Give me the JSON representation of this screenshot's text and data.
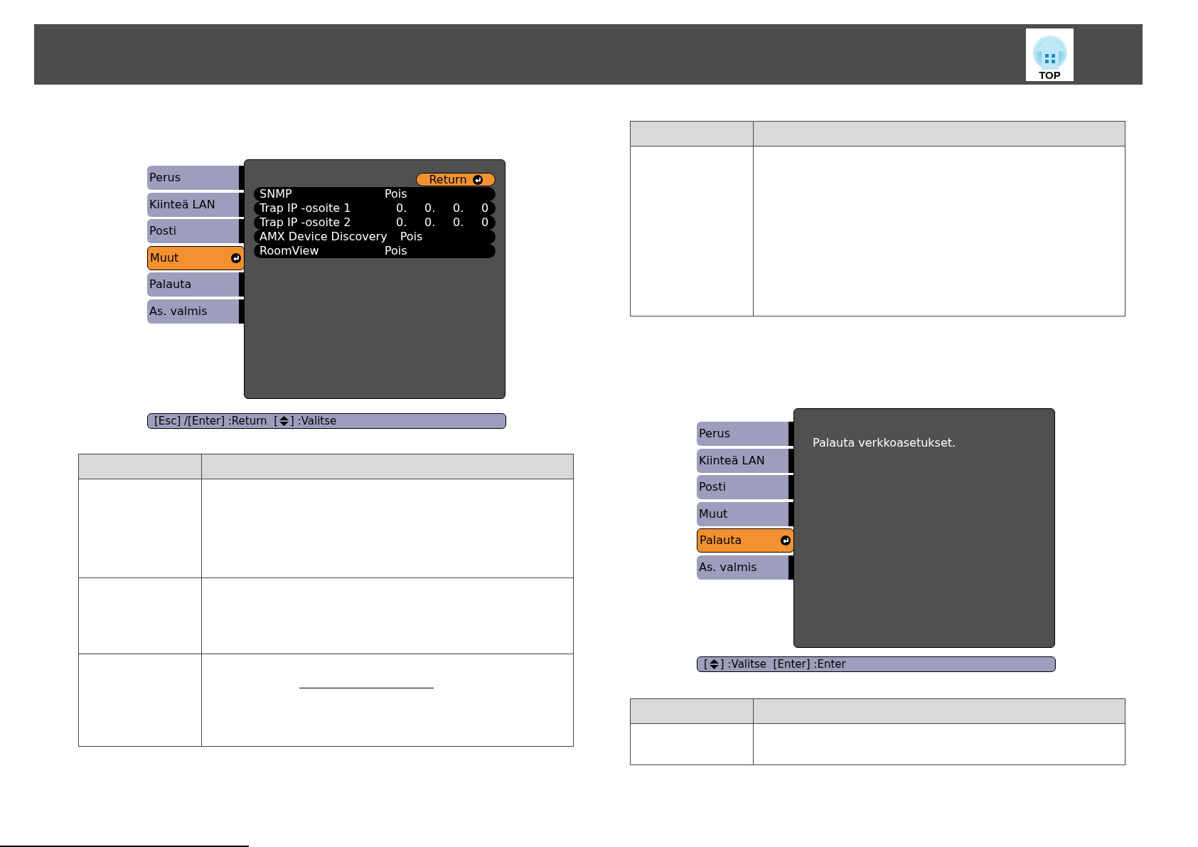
{
  "header": {
    "top_link": {
      "label": "TOP"
    }
  },
  "network_menu": {
    "tabs": [
      {
        "label": "Perus",
        "selected": false
      },
      {
        "label": "Kiinteä LAN",
        "selected": false
      },
      {
        "label": "Posti",
        "selected": false
      },
      {
        "label": "Muut",
        "selected": true
      },
      {
        "label": "Palauta",
        "selected": false
      },
      {
        "label": "As. valmis",
        "selected": false
      }
    ],
    "return_button": {
      "label": "Return"
    },
    "rows": [
      {
        "kind": "value",
        "label": "SNMP",
        "value": "Pois"
      },
      {
        "kind": "ip",
        "label": "Trap IP -osoite 1",
        "octets": [
          "0.",
          "0.",
          "0.",
          "0"
        ]
      },
      {
        "kind": "ip",
        "label": "Trap IP -osoite 2",
        "octets": [
          "0.",
          "0.",
          "0.",
          "0"
        ]
      },
      {
        "kind": "value",
        "label": "AMX Device Discovery",
        "value": "Pois"
      },
      {
        "kind": "value",
        "label": "RoomView",
        "value": "Pois"
      }
    ],
    "help_bar": [
      {
        "kind": "text",
        "text": "[Esc] /[Enter] :Return  ["
      },
      {
        "kind": "updown"
      },
      {
        "kind": "text",
        "text": "] :Valitse"
      }
    ]
  },
  "reset_menu": {
    "tabs": [
      {
        "label": "Perus",
        "selected": false
      },
      {
        "label": "Kiinteä LAN",
        "selected": false
      },
      {
        "label": "Posti",
        "selected": false
      },
      {
        "label": "Muut",
        "selected": false
      },
      {
        "label": "Palauta",
        "selected": true
      },
      {
        "label": "As. valmis",
        "selected": false
      }
    ],
    "message": "Palauta verkkoasetukset.",
    "help_bar": [
      {
        "kind": "text",
        "text": "["
      },
      {
        "kind": "updown"
      },
      {
        "kind": "text",
        "text": "] :Valitse  [Enter] :Enter"
      }
    ]
  }
}
